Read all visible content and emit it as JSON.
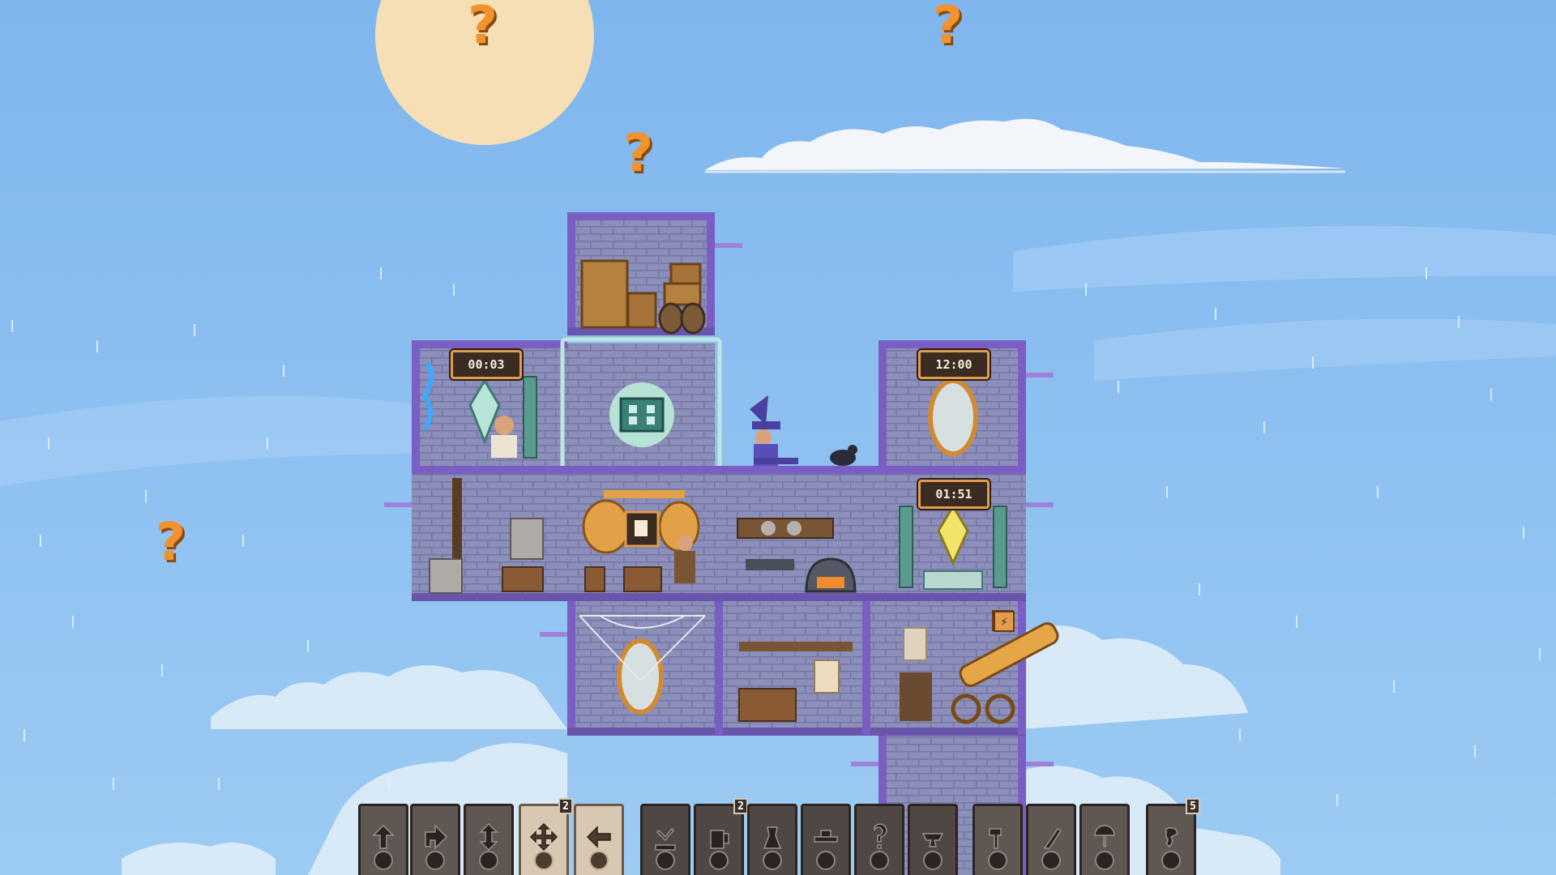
{
  "hud": {
    "question_marks": [
      "?",
      "?",
      "?",
      "?"
    ]
  },
  "rooms": {
    "crystal_timer": "00:03",
    "mirror_timer": "12:00",
    "crystal2_timer": "01:51",
    "energy_badge": "⚡"
  },
  "toolbar": {
    "tools": [
      {
        "icon": "move-up-icon"
      },
      {
        "icon": "move-diagonal-icon"
      },
      {
        "icon": "move-vertical-icon"
      },
      {
        "icon": "move-all-directions-icon",
        "badge": "2"
      },
      {
        "icon": "move-left-icon"
      },
      {
        "icon": "workshop-room-icon"
      },
      {
        "icon": "tavern-mug-icon",
        "badge": "2"
      },
      {
        "icon": "alchemy-room-icon"
      },
      {
        "icon": "forge-room-icon"
      },
      {
        "icon": "question-room-icon"
      },
      {
        "icon": "anvil-room-icon"
      },
      {
        "icon": "hammer-tool-icon"
      },
      {
        "icon": "crowbar-tool-icon"
      },
      {
        "icon": "balloon-tool-icon"
      },
      {
        "icon": "hook-tool-icon",
        "badge": "5"
      }
    ]
  },
  "colors": {
    "sky": "#86bdf0",
    "stone": "#8c8fba",
    "trim": "#7a5ec4",
    "accent": "#f0922e",
    "sun": "#f6dfb4"
  }
}
